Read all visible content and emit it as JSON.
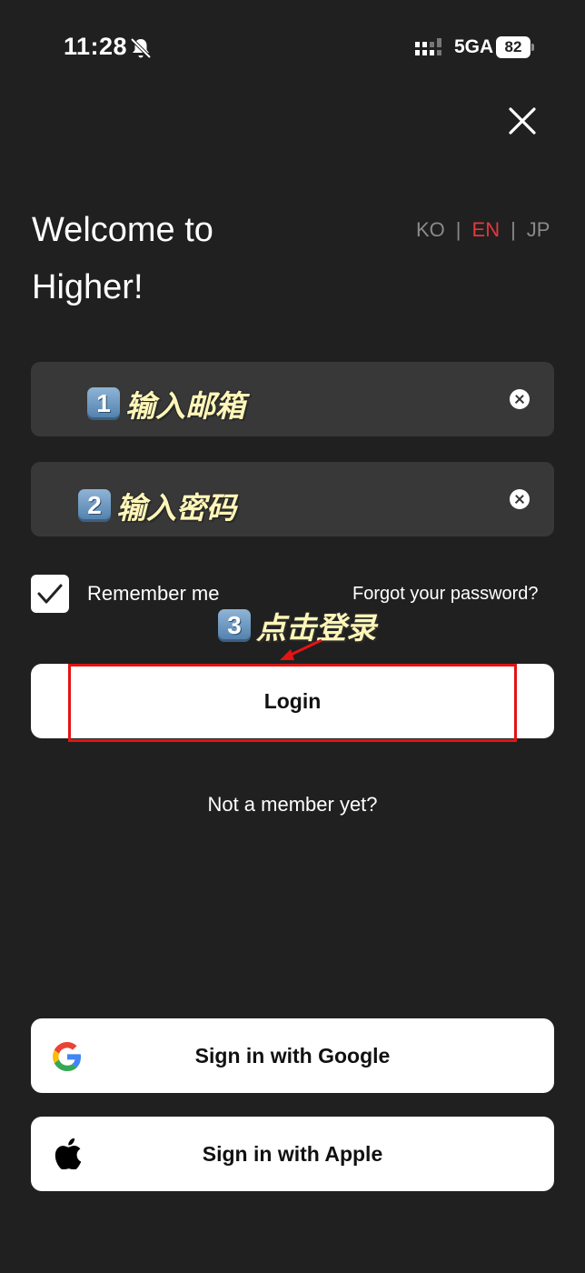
{
  "status_bar": {
    "time": "11:28",
    "network": "5GA",
    "battery": "82"
  },
  "header": {
    "close_icon": "close-icon",
    "welcome_line1": "Welcome to",
    "welcome_line2": "Higher!"
  },
  "language": {
    "options": [
      "KO",
      "EN",
      "JP"
    ],
    "separator": "|",
    "active": "EN",
    "active_color": "#e5373c"
  },
  "form": {
    "email_annotation_num": "1",
    "email_annotation": "输入邮箱",
    "password_annotation_num": "2",
    "password_annotation": "输入密码",
    "remember_label": "Remember me",
    "remember_checked": true,
    "forgot_label": "Forgot your password?",
    "login_annotation_num": "3",
    "login_annotation": "点击登录",
    "login_label": "Login",
    "signup_label": "Not a member yet?"
  },
  "social": {
    "google_label": "Sign in with Google",
    "apple_label": "Sign in with Apple"
  },
  "colors": {
    "background": "#202020",
    "field": "#383838",
    "annotation": "#fff6b8",
    "highlight": "#e31414"
  }
}
